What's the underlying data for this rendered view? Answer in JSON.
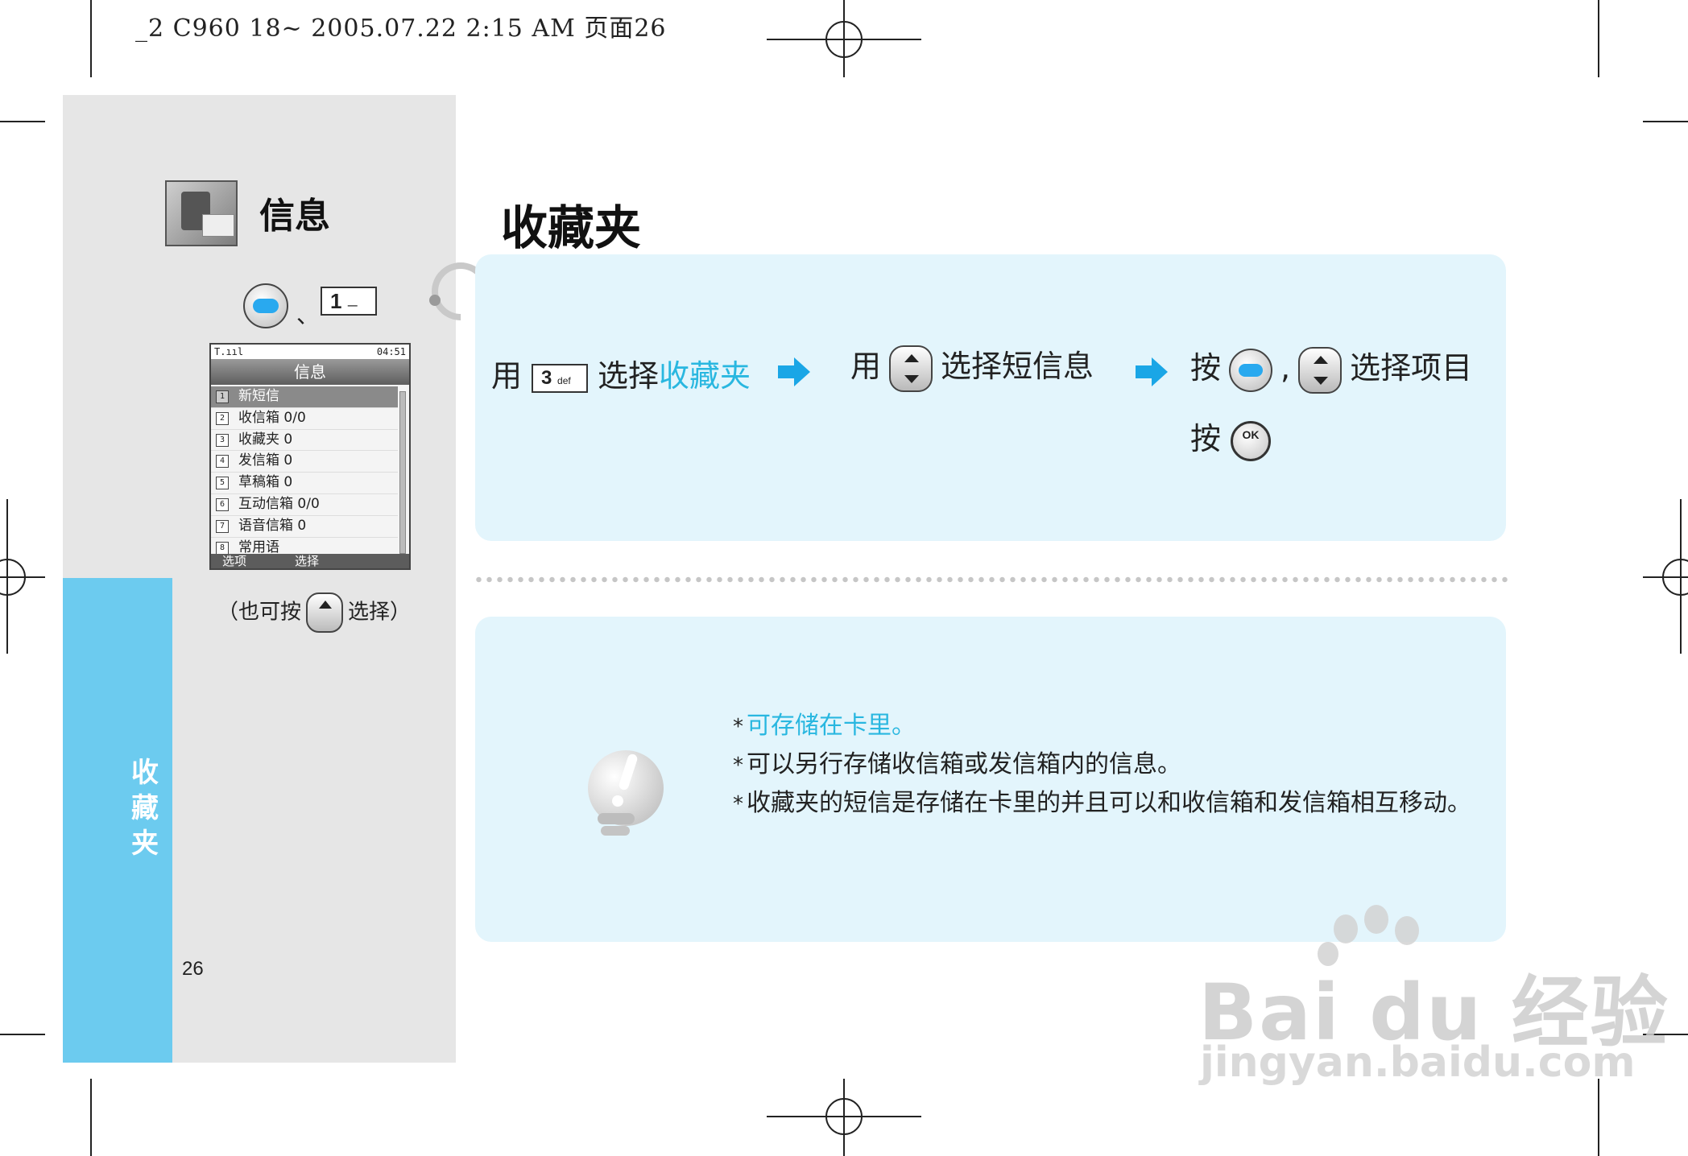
{
  "print_header": "_2 C960 18~ 2005.07.22 2:15 AM 页面26",
  "sidebar": {
    "section_title": "信息",
    "section_icon": "mailbox-icon",
    "key_separator": "、",
    "key_one_label": "1",
    "tab_label": [
      "收",
      "藏",
      "夹"
    ],
    "note_prefix": "（也可按",
    "note_suffix": "选择）",
    "page_number": "26"
  },
  "phone_screen": {
    "status_signal": "T.ııl",
    "status_time": "04:51",
    "title": "信息",
    "items": [
      {
        "num": "1",
        "label": "新短信",
        "selected": true
      },
      {
        "num": "2",
        "label": "收信箱  0/0"
      },
      {
        "num": "3",
        "label": "收藏夹  0"
      },
      {
        "num": "4",
        "label": "发信箱  0"
      },
      {
        "num": "5",
        "label": "草稿箱  0"
      },
      {
        "num": "6",
        "label": "互动信箱  0/0"
      },
      {
        "num": "7",
        "label": "语音信箱  0"
      },
      {
        "num": "8",
        "label": "常用语"
      }
    ],
    "soft_left": "选项",
    "soft_right": "选择"
  },
  "main": {
    "page_title": "收藏夹",
    "steps": {
      "step1_prefix": "用",
      "key3_label": "3",
      "key3_sub": "def",
      "step1_mid": "选择",
      "step1_highlight": "收藏夹",
      "step2_prefix": "用",
      "step2_suffix": "选择短信息",
      "step3_prefix": "按",
      "step3_comma": ",",
      "step3_suffix": "选择项目",
      "step4_prefix": "按",
      "ok_label": "OK"
    },
    "tips": [
      {
        "star": "*",
        "text": "可存储在卡里。",
        "highlight": true
      },
      {
        "star": "*",
        "text": "可以另行存储收信箱或发信箱内的信息。"
      },
      {
        "star": "*",
        "text": "收藏夹的短信是存储在卡里的并且可以和收信箱和发信箱相互移动。"
      }
    ]
  },
  "watermark": {
    "logo": "Bai du 经验",
    "url": "jingyan.baidu.com"
  },
  "colors": {
    "accent_blue": "#29b7e0",
    "strip_blue": "#6ccbef",
    "box_bg": "#e3f5fc",
    "arrow_blue": "#1aa6e6"
  }
}
